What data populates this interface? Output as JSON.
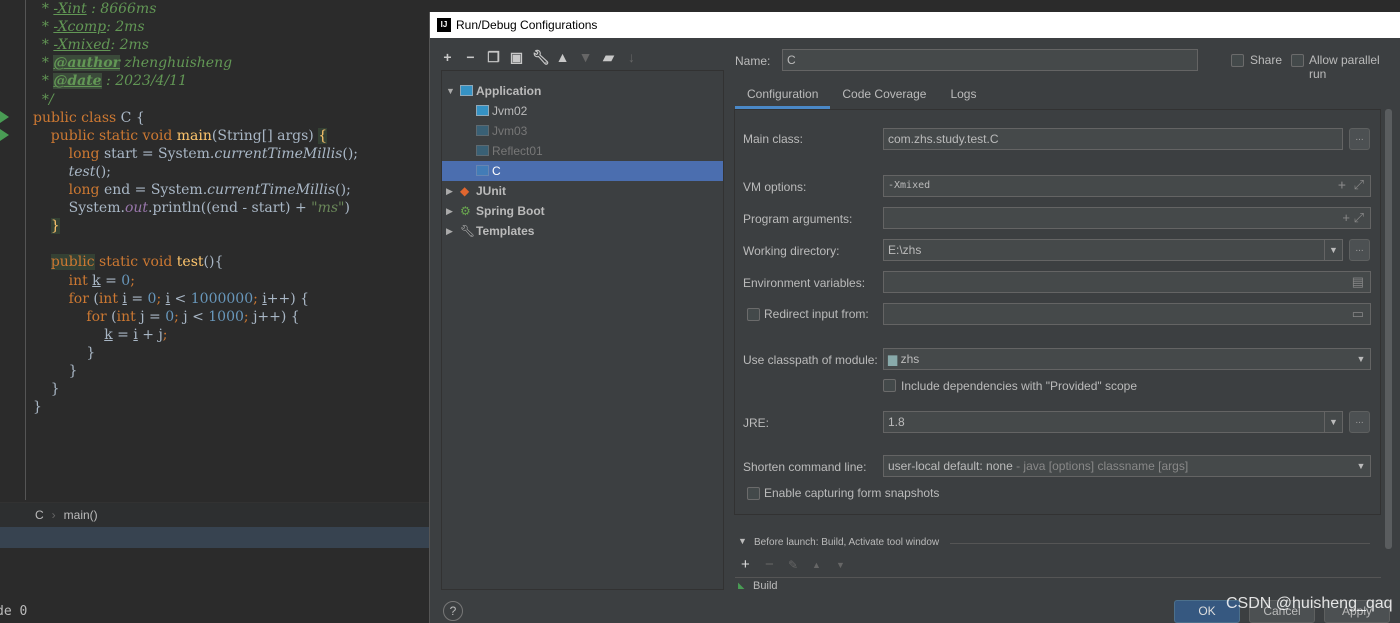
{
  "editor": {
    "lines": [
      [
        {
          "t": "  * ",
          "c": "cm"
        },
        {
          "t": "-Xint",
          "c": "cm ul"
        },
        {
          "t": " : 8666ms",
          "c": "cm"
        }
      ],
      [
        {
          "t": "  * ",
          "c": "cm"
        },
        {
          "t": "-Xcomp",
          "c": "cm ul"
        },
        {
          "t": ": 2ms",
          "c": "cm"
        }
      ],
      [
        {
          "t": "  * ",
          "c": "cm"
        },
        {
          "t": "-Xmixed",
          "c": "cm ul"
        },
        {
          "t": ": 2ms",
          "c": "cm"
        }
      ],
      [
        {
          "t": "  * ",
          "c": "cm"
        },
        {
          "t": "@author",
          "c": "tag"
        },
        {
          "t": " zhenghuisheng",
          "c": "cm"
        }
      ],
      [
        {
          "t": "  * ",
          "c": "cm"
        },
        {
          "t": "@date",
          "c": "tag"
        },
        {
          "t": " : 2023/4/11",
          "c": "cm"
        }
      ],
      [
        {
          "t": "  */",
          "c": "cm"
        }
      ],
      [
        {
          "t": "public class ",
          "c": "kw"
        },
        {
          "t": "C {",
          "c": ""
        }
      ],
      [
        {
          "t": "    public static void ",
          "c": "kw"
        },
        {
          "t": "main",
          "c": "fn"
        },
        {
          "t": "(String[] args) ",
          "c": ""
        },
        {
          "t": "{",
          "c": "fn hl"
        }
      ],
      [
        {
          "t": "        long ",
          "c": "kw"
        },
        {
          "t": "start = System.",
          "c": ""
        },
        {
          "t": "currentTimeMillis",
          "c": "it"
        },
        {
          "t": "();",
          "c": ""
        }
      ],
      [
        {
          "t": "        test",
          "c": "it"
        },
        {
          "t": "();",
          "c": ""
        }
      ],
      [
        {
          "t": "        long ",
          "c": "kw"
        },
        {
          "t": "end = System.",
          "c": ""
        },
        {
          "t": "currentTimeMillis",
          "c": "it"
        },
        {
          "t": "();",
          "c": ""
        }
      ],
      [
        {
          "t": "        System.",
          "c": ""
        },
        {
          "t": "out",
          "c": "sf"
        },
        {
          "t": ".println((end - start) + ",
          "c": ""
        },
        {
          "t": "\"ms\"",
          "c": "str"
        },
        {
          "t": ")",
          "c": ""
        }
      ],
      [
        {
          "t": "    ",
          "c": ""
        },
        {
          "t": "}",
          "c": "fn hl"
        }
      ],
      [],
      [
        {
          "t": "    ",
          "c": ""
        },
        {
          "t": "public",
          "c": "kw hl"
        },
        {
          "t": " static void ",
          "c": "kw"
        },
        {
          "t": "test",
          "c": "fn"
        },
        {
          "t": "(){",
          "c": ""
        }
      ],
      [
        {
          "t": "        int ",
          "c": "kw"
        },
        {
          "t": "k",
          "c": "ul"
        },
        {
          "t": " = ",
          "c": ""
        },
        {
          "t": "0",
          "c": "num"
        },
        {
          "t": ";",
          "c": "kw"
        }
      ],
      [
        {
          "t": "        for ",
          "c": "kw"
        },
        {
          "t": "(",
          "c": ""
        },
        {
          "t": "int ",
          "c": "kw"
        },
        {
          "t": "i",
          "c": "ul"
        },
        {
          "t": " = ",
          "c": ""
        },
        {
          "t": "0",
          "c": "num"
        },
        {
          "t": "; ",
          "c": "kw"
        },
        {
          "t": "i",
          "c": "ul"
        },
        {
          "t": " < ",
          "c": ""
        },
        {
          "t": "1000000",
          "c": "num"
        },
        {
          "t": "; ",
          "c": "kw"
        },
        {
          "t": "i",
          "c": "ul"
        },
        {
          "t": "++) {",
          "c": ""
        }
      ],
      [
        {
          "t": "            for ",
          "c": "kw"
        },
        {
          "t": "(",
          "c": ""
        },
        {
          "t": "int ",
          "c": "kw"
        },
        {
          "t": "j",
          "c": "ul"
        },
        {
          "t": " = ",
          "c": ""
        },
        {
          "t": "0",
          "c": "num"
        },
        {
          "t": "; ",
          "c": "kw"
        },
        {
          "t": "j",
          "c": "ul"
        },
        {
          "t": " < ",
          "c": ""
        },
        {
          "t": "1000",
          "c": "num"
        },
        {
          "t": "; ",
          "c": "kw"
        },
        {
          "t": "j",
          "c": "ul"
        },
        {
          "t": "++) {",
          "c": ""
        }
      ],
      [
        {
          "t": "                ",
          "c": ""
        },
        {
          "t": "k",
          "c": "ul"
        },
        {
          "t": " = ",
          "c": ""
        },
        {
          "t": "i",
          "c": "ul"
        },
        {
          "t": " + ",
          "c": ""
        },
        {
          "t": "j",
          "c": "ul"
        },
        {
          "t": ";",
          "c": "kw"
        }
      ],
      [
        {
          "t": "            }",
          "c": ""
        }
      ],
      [
        {
          "t": "        }",
          "c": ""
        }
      ],
      [
        {
          "t": "    }",
          "c": ""
        }
      ],
      [
        {
          "t": "}",
          "c": ""
        }
      ]
    ],
    "breadcrumb": [
      "C",
      "main()"
    ],
    "status_text": "de 0"
  },
  "dialog": {
    "title": "Run/Debug Configurations",
    "toolbar": [
      "add-icon",
      "remove-icon",
      "copy-icon",
      "save-icon",
      "wrench-icon",
      "move-up-icon",
      "move-down-icon",
      "folder-add-icon",
      "sort-icon"
    ],
    "tree": [
      {
        "label": "Application",
        "level": 0,
        "expanded": true,
        "bold": true
      },
      {
        "label": "Jvm02",
        "level": 1
      },
      {
        "label": "Jvm03",
        "level": 1,
        "dim": true
      },
      {
        "label": "Reflect01",
        "level": 1,
        "dim": true
      },
      {
        "label": "C",
        "level": 1,
        "selected": true
      },
      {
        "label": "JUnit",
        "level": 0,
        "bold": true
      },
      {
        "label": "Spring Boot",
        "level": 0,
        "bold": true
      },
      {
        "label": "Templates",
        "level": 0,
        "bold": true
      }
    ],
    "name_label": "Name:",
    "name_value": "C",
    "share_label": "Share",
    "allow_parallel_label": "Allow parallel run",
    "tabs": [
      "Configuration",
      "Code Coverage",
      "Logs"
    ],
    "active_tab": "Configuration",
    "form": {
      "main_class_label": "Main class:",
      "main_class": "com.zhs.study.test.C",
      "vm_options_label": "VM options:",
      "vm_options": "-Xmixed",
      "program_args_label": "Program arguments:",
      "program_args": "",
      "working_dir_label": "Working directory:",
      "working_dir": "E:\\zhs",
      "env_vars_label": "Environment variables:",
      "env_vars": "",
      "redirect_label": "Redirect input from:",
      "redirect_checked": false,
      "classpath_label": "Use classpath of module:",
      "classpath": "zhs",
      "include_deps_label": "Include dependencies with \"Provided\" scope",
      "include_deps_checked": false,
      "jre_label": "JRE:",
      "jre": "1.8",
      "shorten_label": "Shorten command line:",
      "shorten_value": "user-local default: none",
      "shorten_hint": " - java [options] classname [args]",
      "snapshots_label": "Enable capturing form snapshots",
      "snapshots_checked": false
    },
    "before_launch_label": "Before launch: Build, Activate tool window",
    "before_launch_items": [
      "Build"
    ],
    "buttons": {
      "ok": "OK",
      "cancel": "Cancel",
      "apply": "Apply"
    },
    "help": "?"
  },
  "watermark": "CSDN @huisheng_qaq",
  "colors": {
    "selection": "#4b6eaf",
    "tab_underline": "#4a88c7",
    "keyword": "#cc7832",
    "comment": "#629755"
  }
}
